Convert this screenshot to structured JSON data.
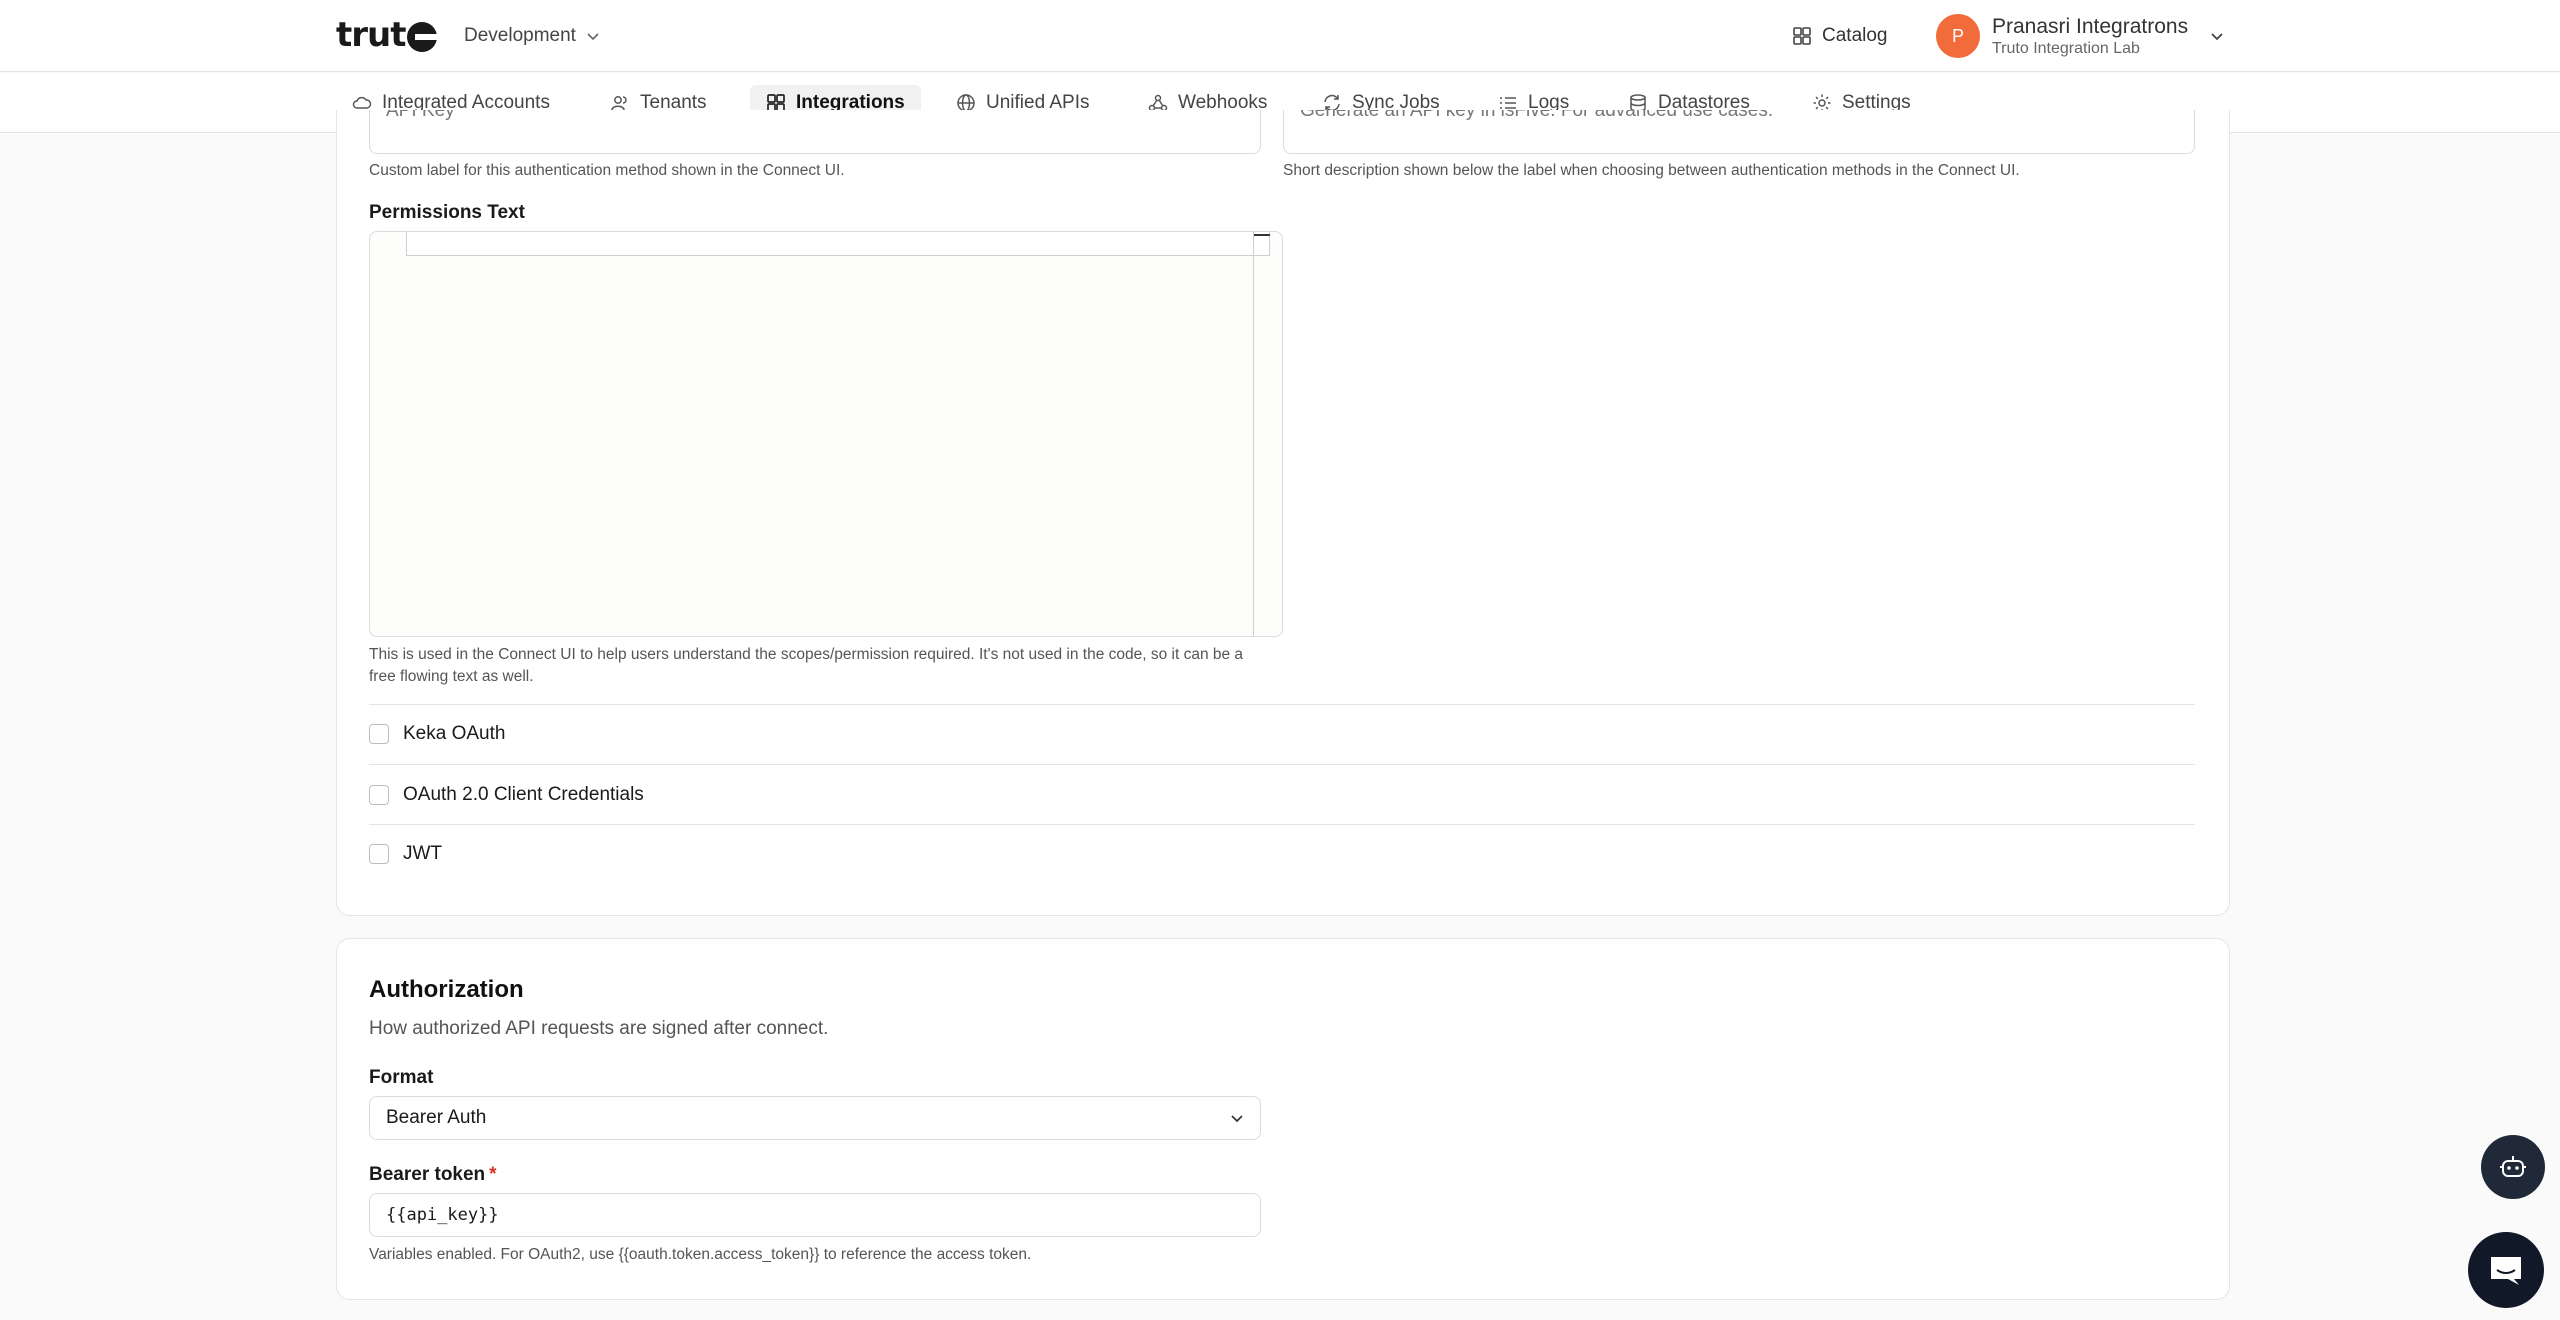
{
  "header": {
    "logo_text": "trut",
    "environment": "Development",
    "catalog_label": "Catalog",
    "user": {
      "initial": "P",
      "name": "Pranasri Integratrons",
      "org": "Truto Integration Lab"
    }
  },
  "nav": {
    "items": [
      {
        "label": "Integrated Accounts",
        "icon": "cloud-icon"
      },
      {
        "label": "Tenants",
        "icon": "users-icon"
      },
      {
        "label": "Integrations",
        "icon": "grid-icon",
        "active": true
      },
      {
        "label": "Unified APIs",
        "icon": "globe-icon"
      },
      {
        "label": "Webhooks",
        "icon": "webhook-icon"
      },
      {
        "label": "Sync Jobs",
        "icon": "sync-icon"
      },
      {
        "label": "Logs",
        "icon": "list-icon"
      },
      {
        "label": "Datastores",
        "icon": "database-icon"
      },
      {
        "label": "Settings",
        "icon": "gear-icon"
      }
    ]
  },
  "auth_method": {
    "label_value": "API Key",
    "label_help": "Custom label for this authentication method shown in the Connect UI.",
    "description_value": "Generate an API key in isFive. For advanced use cases.",
    "description_help": "Short description shown below the label when choosing between authentication methods in the Connect UI.",
    "permissions_label": "Permissions Text",
    "permissions_help": "This is used in the Connect UI to help users understand the scopes/permission required. It's not used in the code, so it can be a free flowing text as well.",
    "options": [
      {
        "label": "Keka OAuth",
        "checked": false
      },
      {
        "label": "OAuth 2.0 Client Credentials",
        "checked": false
      },
      {
        "label": "JWT",
        "checked": false
      }
    ]
  },
  "authorization": {
    "title": "Authorization",
    "subtitle": "How authorized API requests are signed after connect.",
    "format_label": "Format",
    "format_value": "Bearer Auth",
    "token_label": "Bearer token",
    "token_required": "*",
    "token_value": "{{api_key}}",
    "token_help": "Variables enabled. For OAuth2, use {{oauth.token.access_token}} to reference the access token."
  }
}
